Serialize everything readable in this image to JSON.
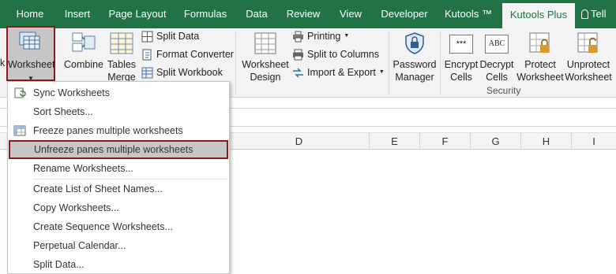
{
  "tabs": [
    {
      "label": "Home"
    },
    {
      "label": "Insert"
    },
    {
      "label": "Page Layout"
    },
    {
      "label": "Formulas"
    },
    {
      "label": "Data"
    },
    {
      "label": "Review"
    },
    {
      "label": "View"
    },
    {
      "label": "Developer"
    },
    {
      "label": "Kutools ™"
    },
    {
      "label": "Kutools Plus"
    },
    {
      "label": "Tell"
    }
  ],
  "ribbon": {
    "worksheet_partial": "k",
    "worksheet": "Worksheet",
    "combine": "Combine",
    "tables_merge": [
      "Tables",
      "Merge"
    ],
    "split_data": "Split Data",
    "format_converter": "Format Converter",
    "split_workbook": "Split Workbook",
    "worksheet_design": [
      "Worksheet",
      "Design"
    ],
    "printing": "Printing",
    "split_to_columns": "Split to Columns",
    "import_export": "Import & Export",
    "password_manager": [
      "Password",
      "Manager"
    ],
    "encrypt_cells": [
      "Encrypt",
      "Cells"
    ],
    "decrypt_cells": [
      "Decrypt",
      "Cells"
    ],
    "protect_worksheet": [
      "Protect",
      "Worksheet"
    ],
    "unprotect_worksheet": [
      "Unprotect",
      "Worksheet"
    ],
    "security_group": "Security"
  },
  "columns": [
    "D",
    "E",
    "F",
    "G",
    "H",
    "I"
  ],
  "menu": {
    "items": [
      "Sync Worksheets",
      "Sort Sheets...",
      "Freeze panes multiple worksheets",
      "Unfreeze panes multiple worksheets",
      "Rename Worksheets...",
      "Create List of Sheet Names...",
      "Copy Worksheets...",
      "Create Sequence Worksheets...",
      "Perpetual Calendar...",
      "Split Data..."
    ]
  },
  "colors": {
    "ribbon_green": "#217346",
    "highlight_border": "#8b1a1a"
  }
}
